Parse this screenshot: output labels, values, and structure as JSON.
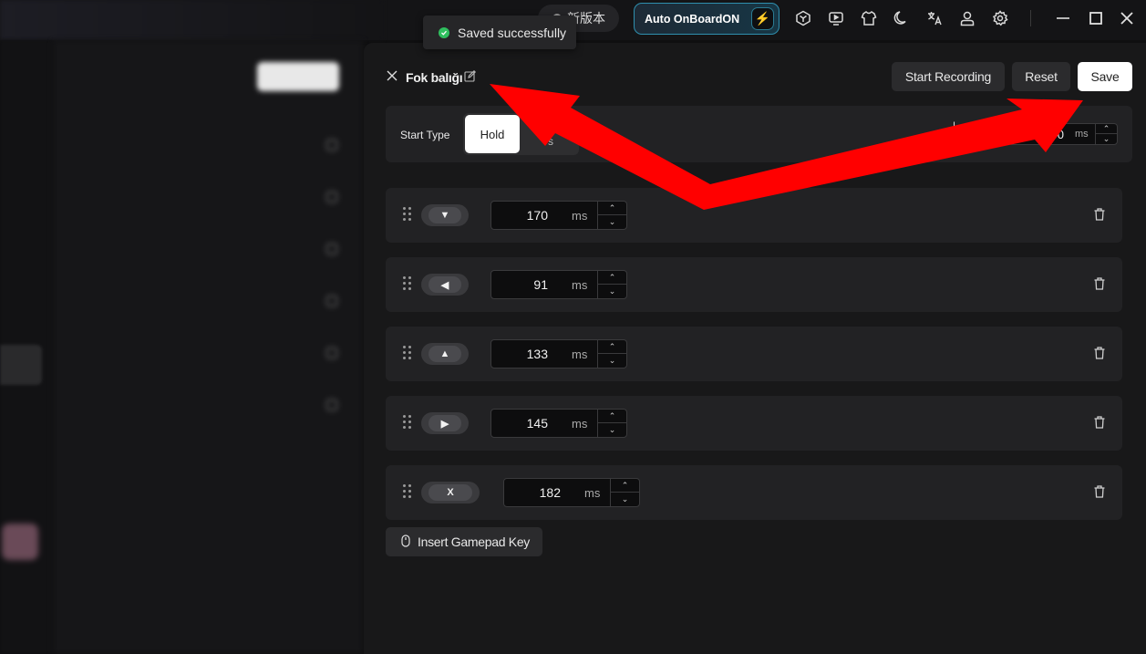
{
  "topbar": {
    "update_label": "新版本",
    "auto_onboard_label": "Auto OnBoardON"
  },
  "toast": {
    "text": "Saved successfully"
  },
  "macro": {
    "name": "Fok balığı",
    "start_recording": "Start Recording",
    "reset": "Reset",
    "save": "Save"
  },
  "start_type": {
    "label": "Start Type",
    "hold": "Hold",
    "other": "s",
    "interval_label_top": "I",
    "interval_label": "Time",
    "interval_value": "200",
    "interval_unit": "ms"
  },
  "actions": [
    {
      "key": "▼",
      "value": "170",
      "unit": "ms"
    },
    {
      "key": "◀",
      "value": "91",
      "unit": "ms"
    },
    {
      "key": "▲",
      "value": "133",
      "unit": "ms"
    },
    {
      "key": "▶",
      "value": "145",
      "unit": "ms"
    },
    {
      "key": "X",
      "value": "182",
      "unit": "ms"
    }
  ],
  "insert_button": "Insert Gamepad Key",
  "colors": {
    "annotation_arrow": "#ff0000",
    "accent": "#2f8fae",
    "success": "#2fbf5e"
  }
}
